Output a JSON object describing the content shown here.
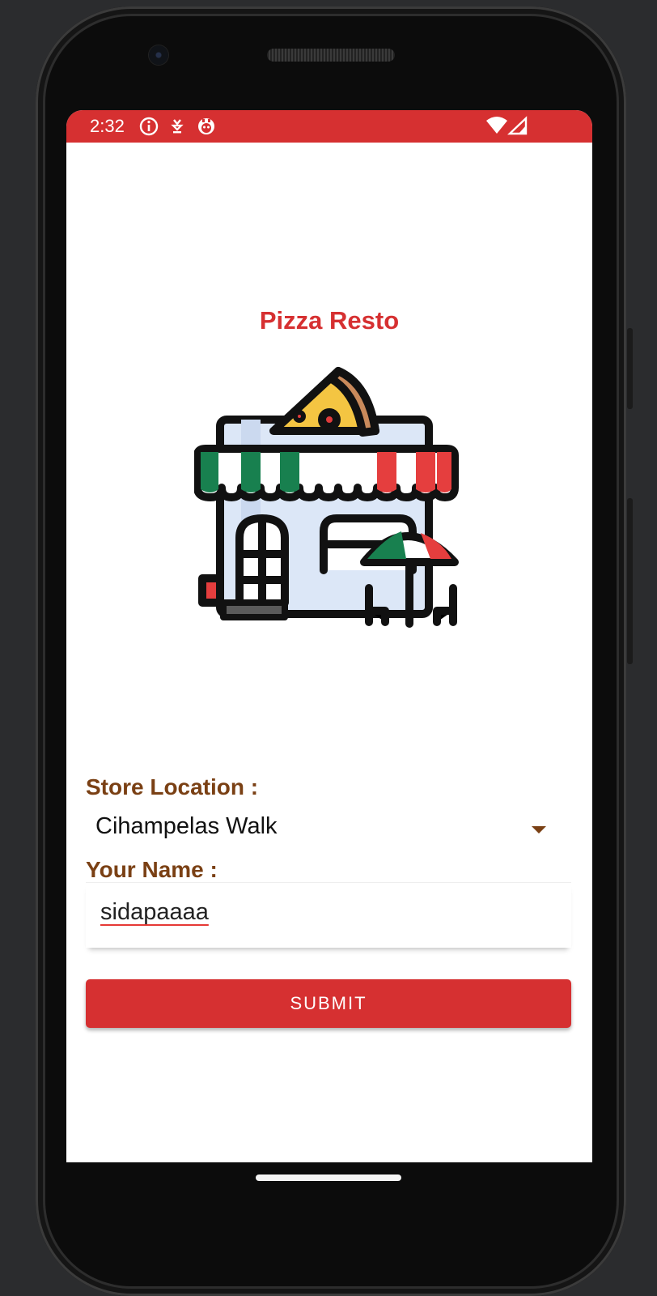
{
  "status_bar": {
    "time": "2:32",
    "background": "#d63031",
    "icons": [
      "info-icon",
      "download-icon",
      "app-notification-icon",
      "wifi-icon",
      "cellular-signal-icon"
    ]
  },
  "app": {
    "title": "Pizza Resto",
    "logo": "pizza-store-icon",
    "accent_color": "#d63031",
    "label_color": "#7a4014"
  },
  "form": {
    "store_location_label": "Store Location :",
    "store_location_value": "Cihampelas Walk",
    "name_label": "Your Name :",
    "name_value": "sidapaaaa",
    "submit_label": "SUBMIT"
  }
}
